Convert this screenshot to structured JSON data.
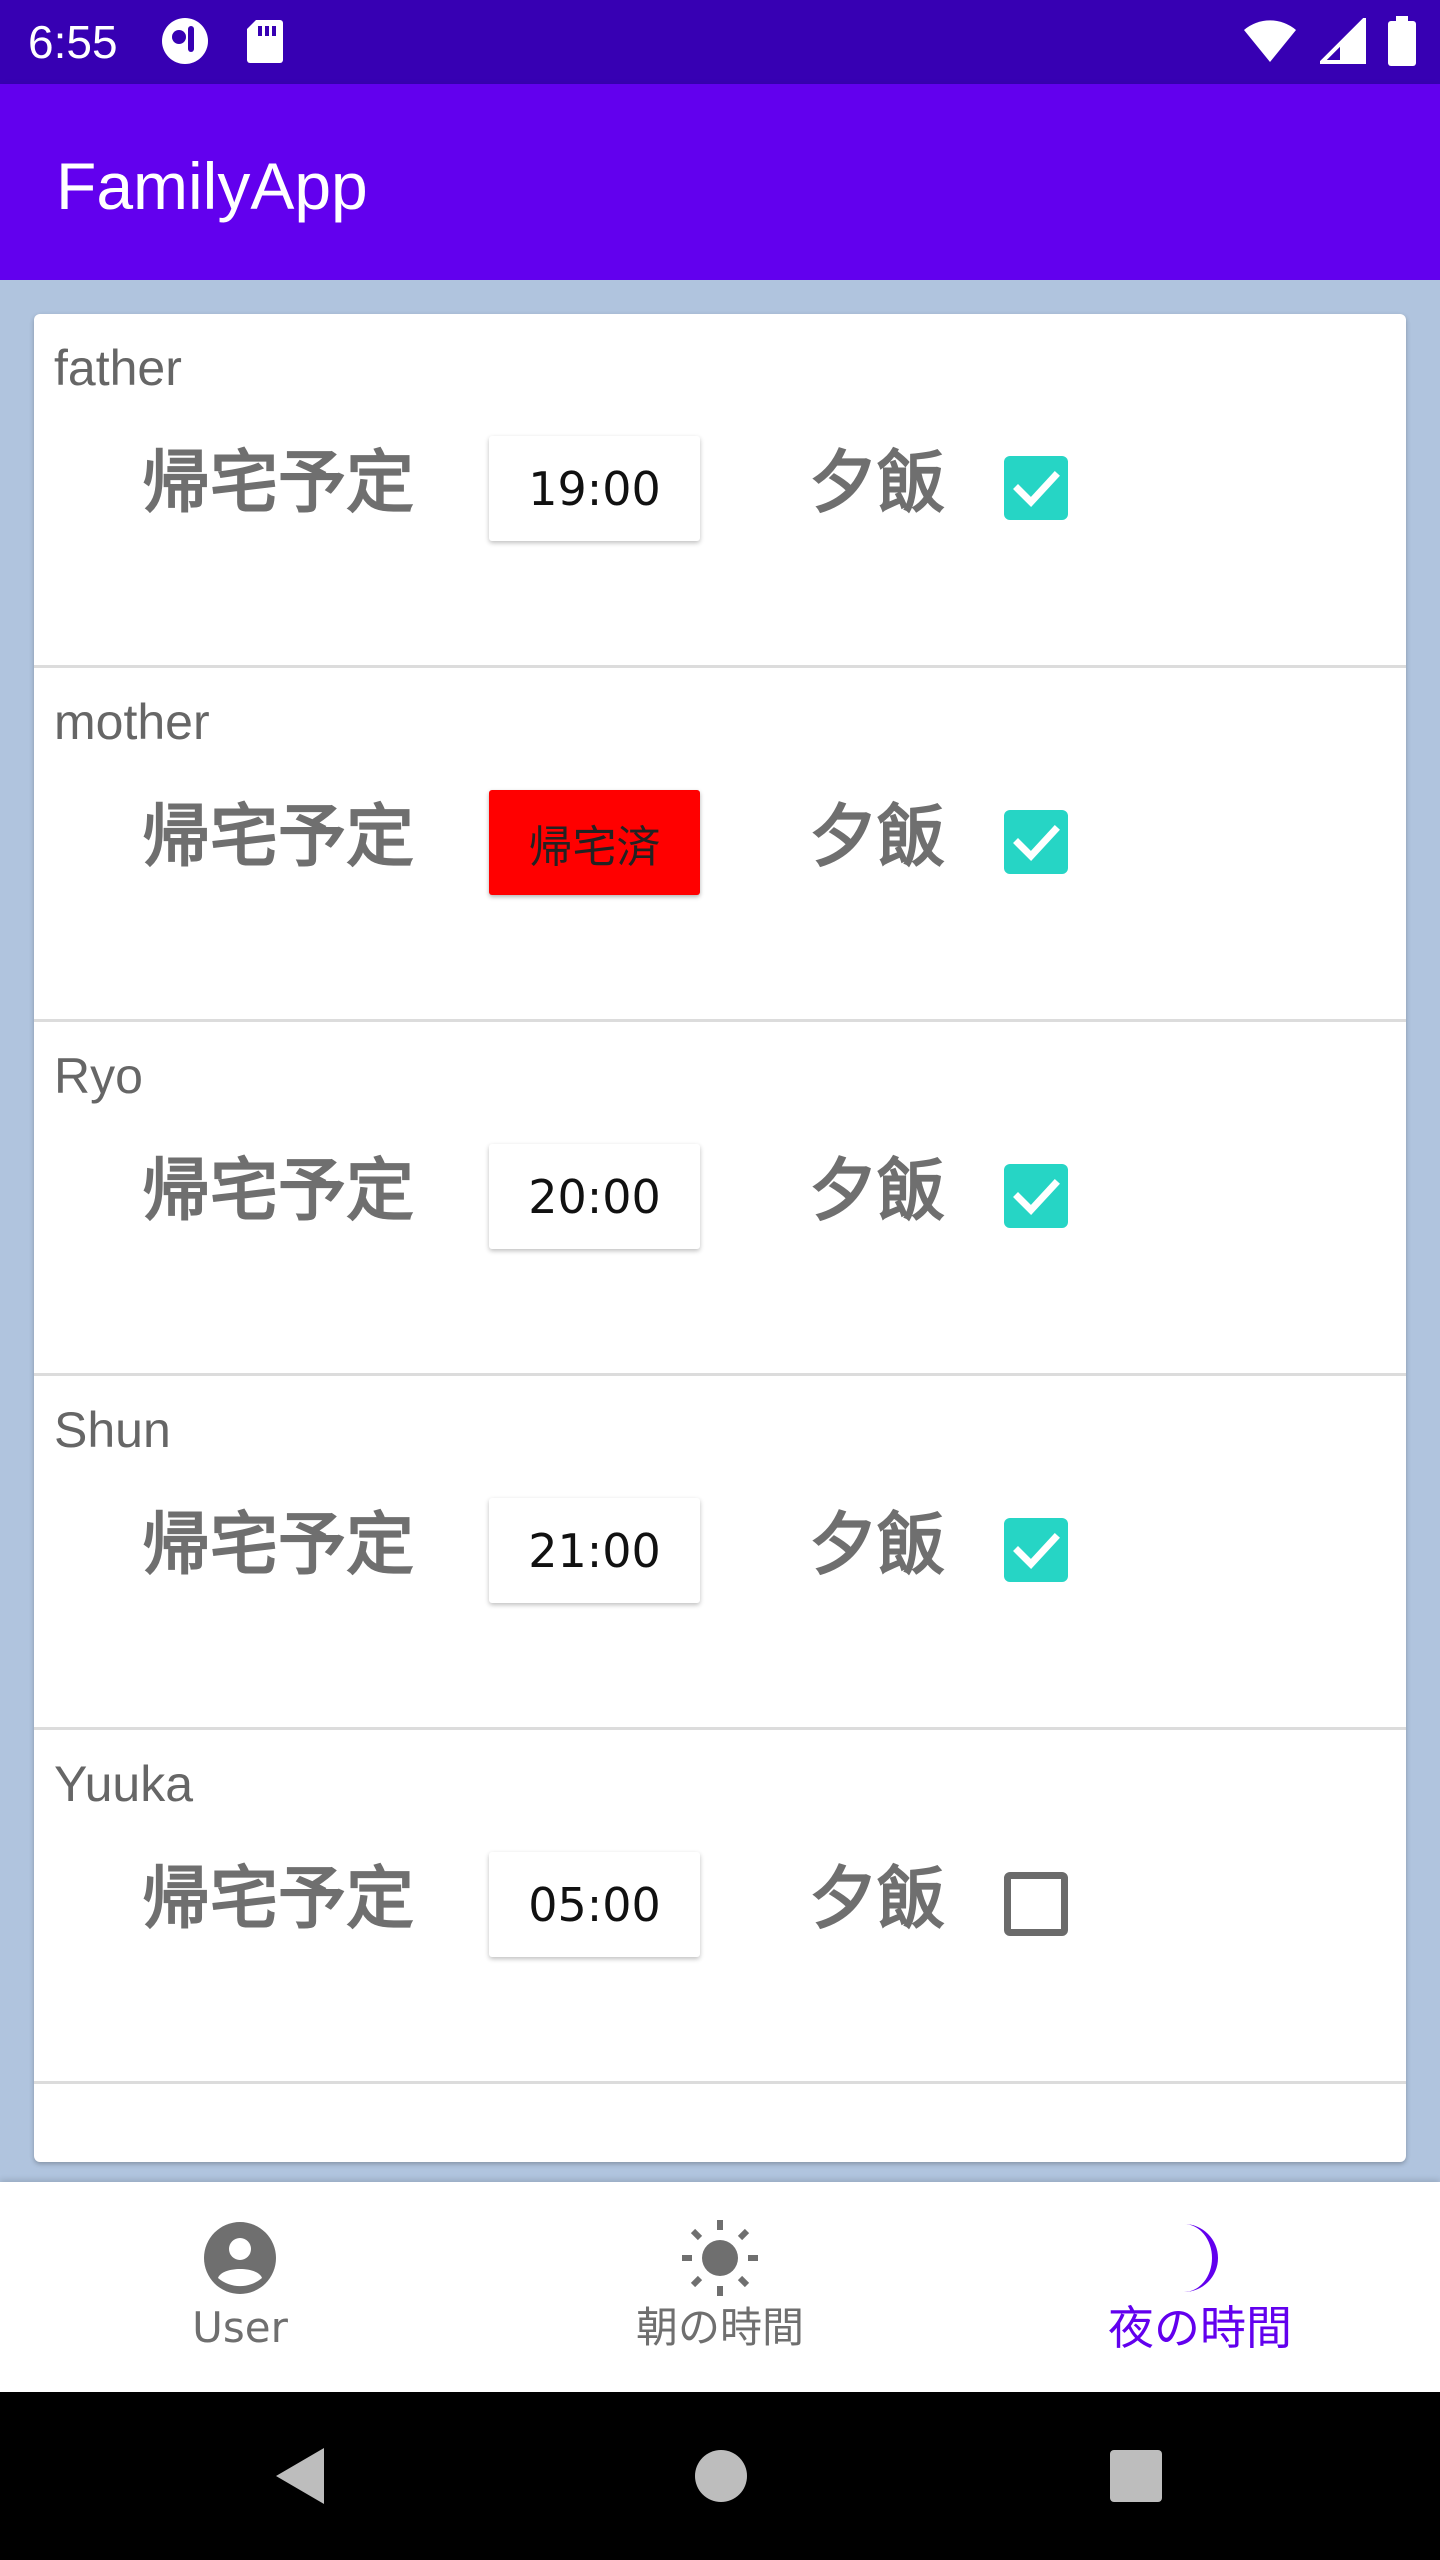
{
  "status_bar": {
    "time": "6:55"
  },
  "app_bar": {
    "title": "FamilyApp"
  },
  "labels": {
    "return_home": "帰宅予定",
    "dinner": "夕飯"
  },
  "members": [
    {
      "name": "father",
      "status": "19:00",
      "returned": false,
      "dinner": true
    },
    {
      "name": "mother",
      "status": "帰宅済",
      "returned": true,
      "dinner": true
    },
    {
      "name": "Ryo",
      "status": "20:00",
      "returned": false,
      "dinner": true
    },
    {
      "name": "Shun",
      "status": "21:00",
      "returned": false,
      "dinner": true
    },
    {
      "name": "Yuuka",
      "status": "05:00",
      "returned": false,
      "dinner": false
    }
  ],
  "bottom_nav": {
    "items": [
      {
        "label": "User",
        "icon": "account-circle-icon",
        "active": false
      },
      {
        "label": "朝の時間",
        "icon": "sun-icon",
        "active": false
      },
      {
        "label": "夜の時間",
        "icon": "moon-icon",
        "active": true
      }
    ]
  },
  "colors": {
    "primary": "#6200ee",
    "primary_dark": "#3700b3",
    "background": "#b0c4de",
    "checkbox_checked": "#26d5c5",
    "returned_badge": "#ff0000"
  }
}
